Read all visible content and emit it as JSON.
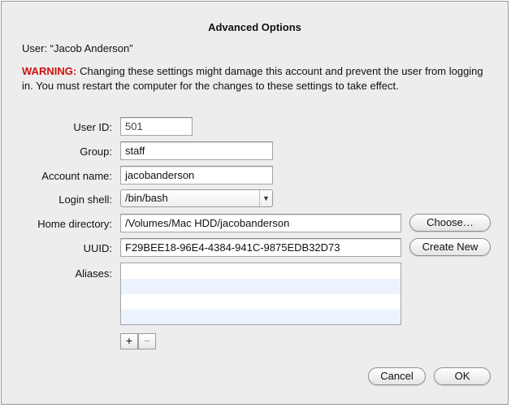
{
  "dialog": {
    "title": "Advanced Options",
    "user_line": "User: “Jacob Anderson”",
    "warning_label": "WARNING:",
    "warning_text": "Changing these settings might damage this account and prevent the user from logging in. You must restart the computer for the changes to these settings to take effect."
  },
  "fields": {
    "user_id": {
      "label": "User ID:",
      "value": "501"
    },
    "group": {
      "label": "Group:",
      "value": "staff"
    },
    "account_name": {
      "label": "Account name:",
      "value": "jacobanderson"
    },
    "login_shell": {
      "label": "Login shell:",
      "value": "/bin/bash"
    },
    "home_directory": {
      "label": "Home directory:",
      "value": "/Volumes/Mac HDD/jacobanderson",
      "button": "Choose…"
    },
    "uuid": {
      "label": "UUID:",
      "value": "F29BEE18-96E4-4384-941C-9875EDB32D73",
      "button": "Create New"
    },
    "aliases": {
      "label": "Aliases:"
    }
  },
  "list_controls": {
    "add": "+",
    "remove": "−"
  },
  "footer": {
    "cancel": "Cancel",
    "ok": "OK"
  },
  "colors": {
    "warning": "#d01010",
    "alt_row": "#edf3fe"
  }
}
